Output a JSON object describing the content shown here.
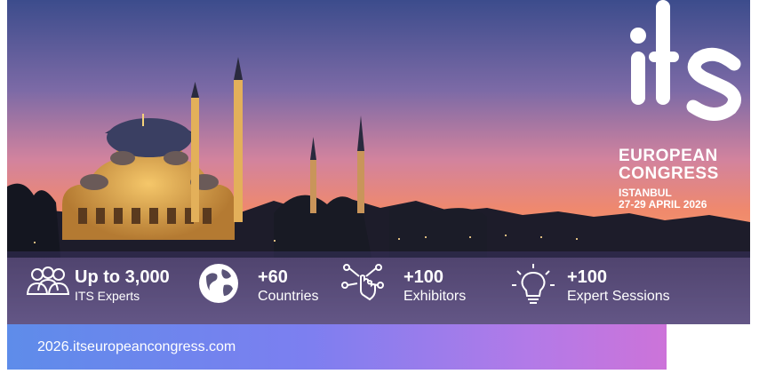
{
  "logo": {
    "mark": "its",
    "line1": "EUROPEAN",
    "line2": "CONGRESS",
    "city": "ISTANBUL",
    "dates": "27-29 APRIL 2026"
  },
  "stats": [
    {
      "number": "Up to 3,000",
      "label": "ITS Experts",
      "icon": "people-icon"
    },
    {
      "number": "+60",
      "label": "Countries",
      "icon": "globe-icon"
    },
    {
      "number": "+100",
      "label": "Exhibitors",
      "icon": "network-hand-icon"
    },
    {
      "number": "+100",
      "label": "Expert Sessions",
      "icon": "lightbulb-icon"
    }
  ],
  "website": "2026.itseuropeancongress.com",
  "colors": {
    "sky_top": "#3c4c8c",
    "sky_bottom": "#f07a6a",
    "url_gradient_start": "#5e8cea",
    "url_gradient_end": "#dc6fd0",
    "text": "#ffffff"
  }
}
